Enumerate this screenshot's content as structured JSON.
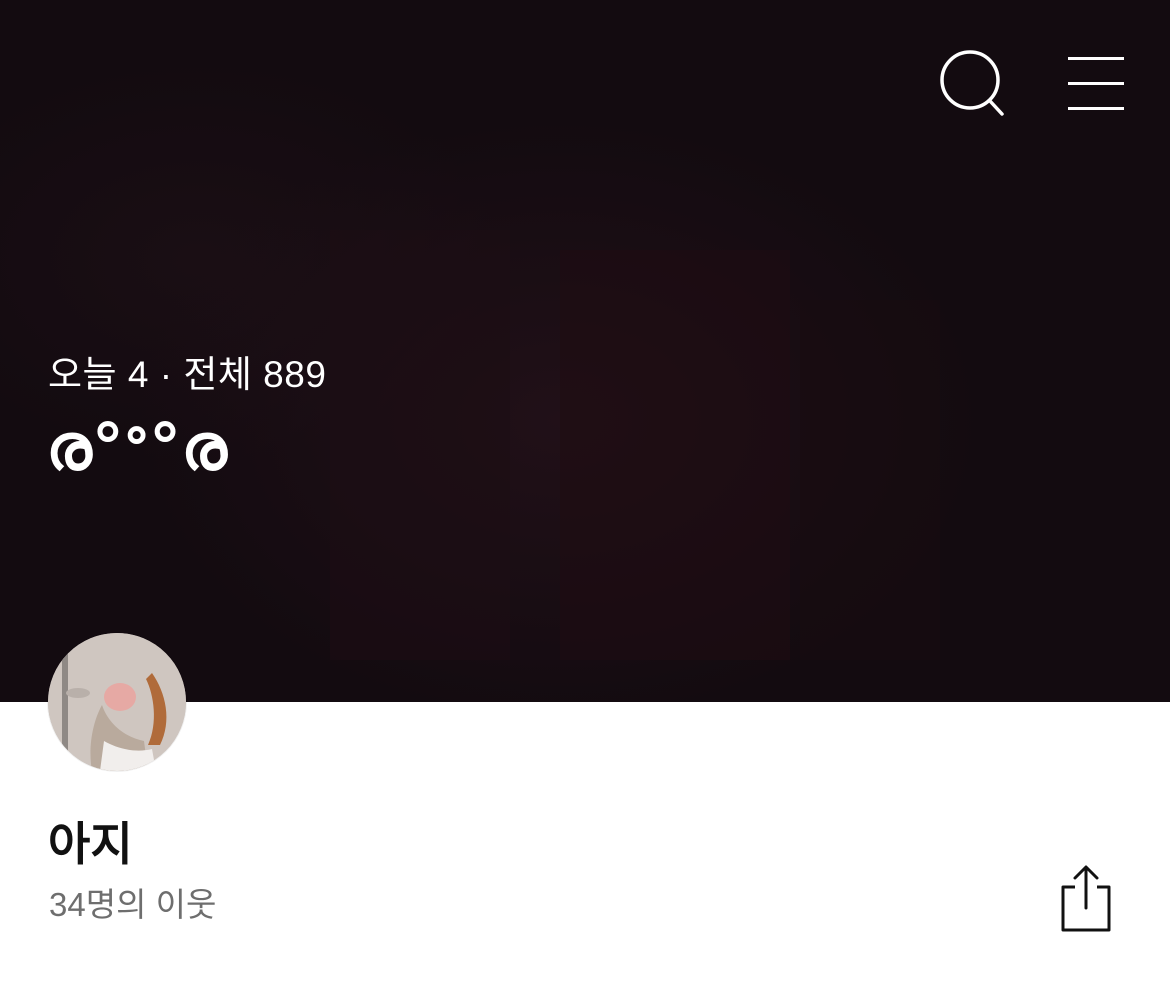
{
  "header": {
    "search_icon": "search-icon",
    "menu_icon": "hamburger-menu-icon",
    "visits_text": "오늘 4 · 전체 889",
    "blog_title": "ര°ᐤ°ര"
  },
  "profile": {
    "nickname": "아지",
    "neighbors_text": "34명의 이웃",
    "share_icon": "share-icon"
  },
  "colors": {
    "hero_background": "#130b10",
    "nickname_text": "#111111",
    "neighbors_text": "#6e6e6e"
  }
}
